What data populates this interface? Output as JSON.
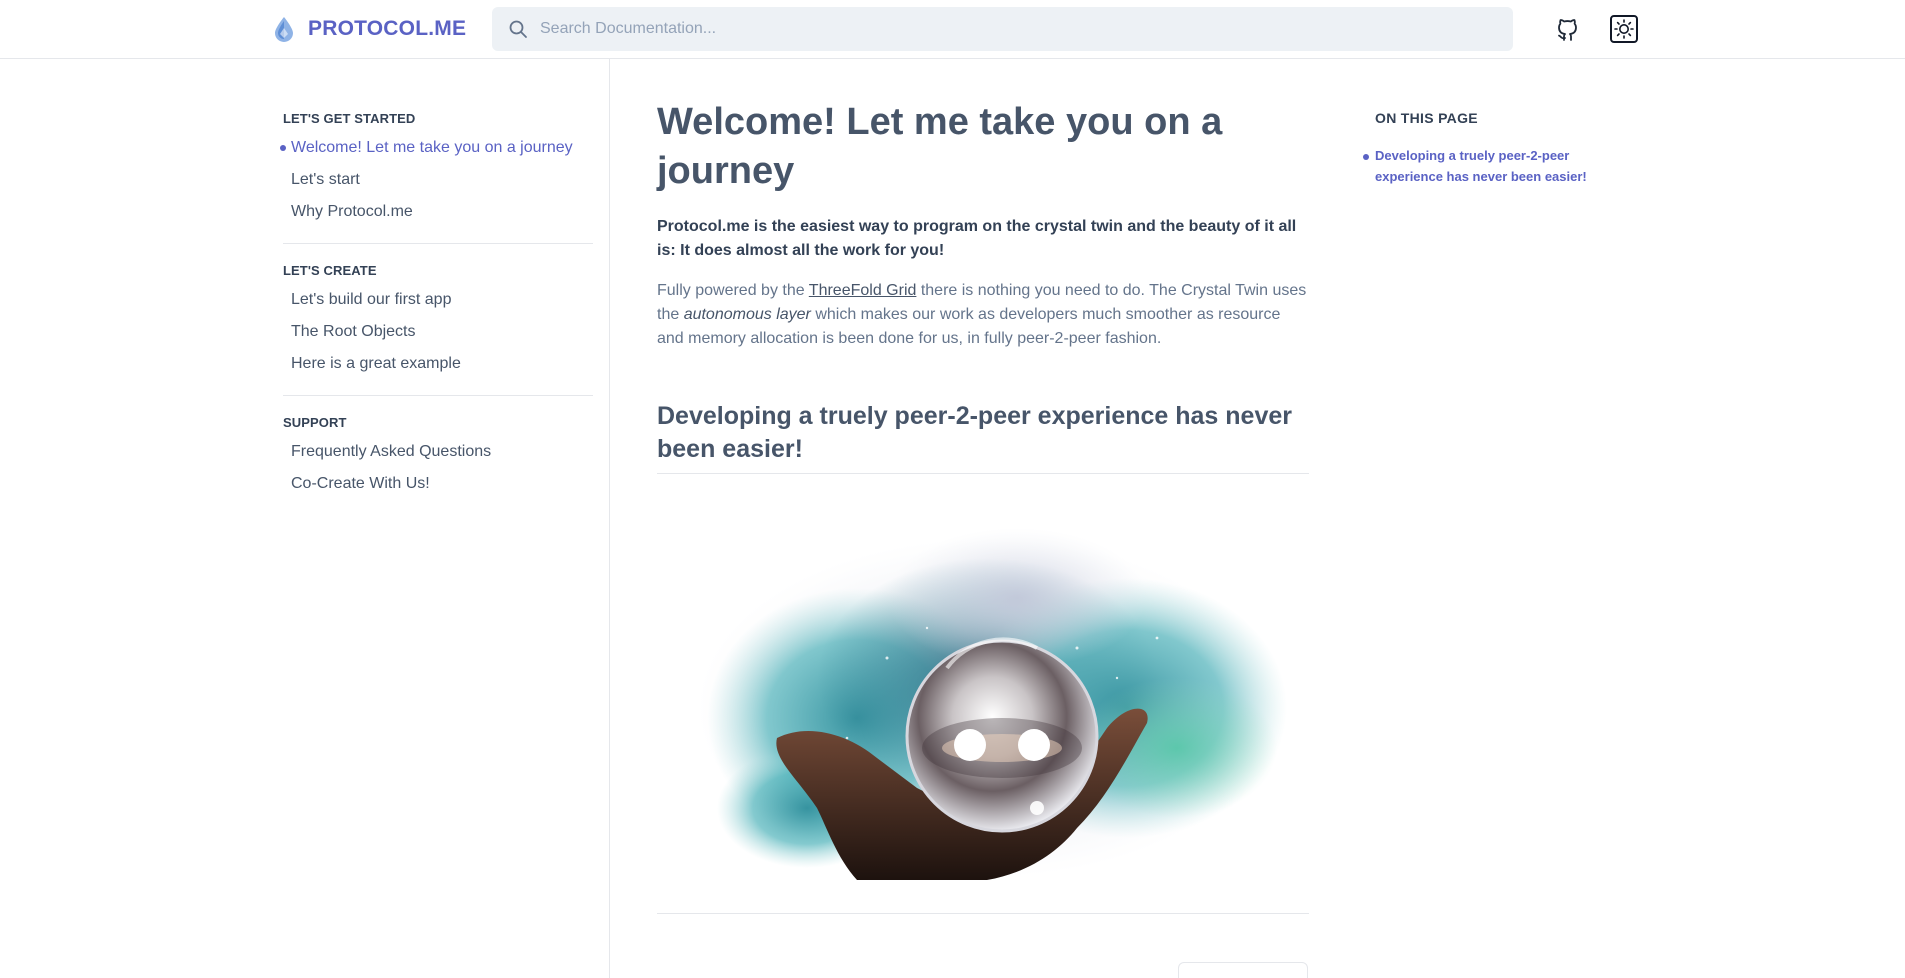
{
  "header": {
    "logo_text": "PROTOCOL.ME",
    "search_placeholder": "Search Documentation...",
    "github_icon": "github-icon",
    "theme_icon": "sun-icon"
  },
  "sidebar": {
    "sections": [
      {
        "heading": "LET'S GET STARTED",
        "items": [
          {
            "label": "Welcome! Let me take you on a journey",
            "active": true
          },
          {
            "label": "Let's start"
          },
          {
            "label": "Why Protocol.me"
          }
        ]
      },
      {
        "heading": "LET'S CREATE",
        "items": [
          {
            "label": "Let's build our first app"
          },
          {
            "label": "The Root Objects"
          },
          {
            "label": "Here is a great example"
          }
        ]
      },
      {
        "heading": "SUPPORT",
        "items": [
          {
            "label": "Frequently Asked Questions"
          },
          {
            "label": "Co-Create With Us!"
          }
        ]
      }
    ]
  },
  "main": {
    "title": "Welcome! Let me take you on a journey",
    "lead": "Protocol.me is the easiest way to program on the crystal twin and the beauty of it all is: It does almost all the work for you!",
    "body_prefix": "Fully powered by the ",
    "body_link": "ThreeFold Grid",
    "body_middle": " there is nothing you need to do. The Crystal Twin uses the ",
    "body_emphasis": "autonomous layer",
    "body_suffix": " which makes our work as developers much smoother as resource and memory allocation is been done for us, in fully peer-2-peer fashion.",
    "section_title": "Developing a truely peer-2-peer experience has never been easier!"
  },
  "toc": {
    "heading": "ON THIS PAGE",
    "items": [
      {
        "label": "Developing a truely peer-2-peer experience has never been easier!"
      }
    ]
  },
  "colors": {
    "accent": "#5a62c4",
    "heading": "#475569",
    "search_bg": "#edf1f5"
  }
}
